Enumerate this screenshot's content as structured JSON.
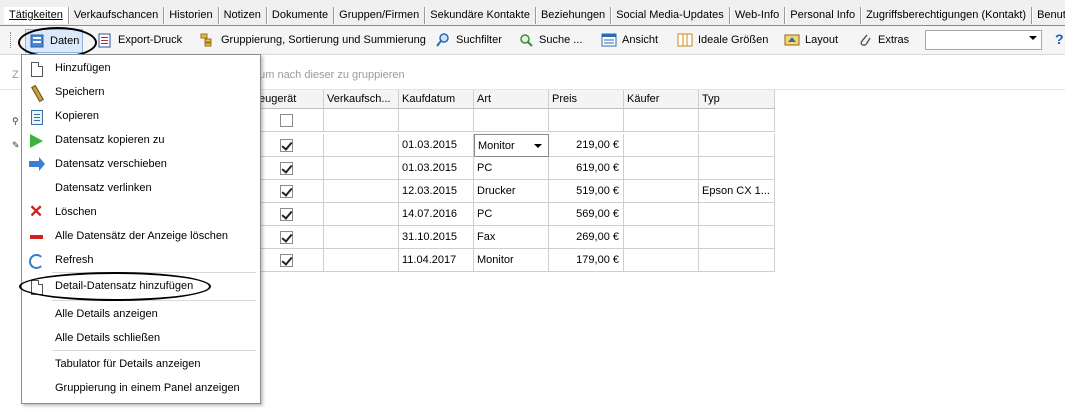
{
  "tabs": [
    "Tätigkeiten",
    "Verkaufschancen",
    "Historien",
    "Notizen",
    "Dokumente",
    "Gruppen/Firmen",
    "Sekundäre Kontakte",
    "Beziehungen",
    "Social Media-Updates",
    "Web-Info",
    "Personal Info",
    "Zugriffsberechtigungen (Kontakt)",
    "Benutze"
  ],
  "toolbar": {
    "daten": "Daten",
    "export": "Export-Druck",
    "grouping": "Gruppierung, Sortierung und Summierung",
    "suchfilter": "Suchfilter",
    "suche": "Suche ...",
    "ansicht": "Ansicht",
    "ideale": "Ideale Größen",
    "layout": "Layout",
    "extras": "Extras",
    "select_value": ""
  },
  "group_hint": "Z",
  "group_hint_rest": ", um nach dieser zu gruppieren",
  "columns": [
    "eugerät",
    "Verkaufsch...",
    "Kaufdatum",
    "Art",
    "Preis",
    "Käufer",
    "Typ"
  ],
  "rows": [
    {
      "geraet": true,
      "vk": "",
      "datum": "01.03.2015",
      "art": "Monitor",
      "preis": "219,00 €",
      "kaeufer": "",
      "typ": ""
    },
    {
      "geraet": true,
      "vk": "",
      "datum": "01.03.2015",
      "art": "PC",
      "preis": "619,00 €",
      "kaeufer": "",
      "typ": ""
    },
    {
      "geraet": true,
      "vk": "",
      "datum": "12.03.2015",
      "art": "Drucker",
      "preis": "519,00 €",
      "kaeufer": "",
      "typ": "Epson CX 1..."
    },
    {
      "geraet": true,
      "vk": "",
      "datum": "14.07.2016",
      "art": "PC",
      "preis": "569,00 €",
      "kaeufer": "",
      "typ": ""
    },
    {
      "geraet": true,
      "vk": "",
      "datum": "31.10.2015",
      "art": "Fax",
      "preis": "269,00 €",
      "kaeufer": "",
      "typ": ""
    },
    {
      "geraet": true,
      "vk": "",
      "datum": "11.04.2017",
      "art": "Monitor",
      "preis": "179,00 €",
      "kaeufer": "",
      "typ": ""
    }
  ],
  "menu": {
    "items": [
      {
        "label": "Hinzufügen",
        "icon": "document-icon"
      },
      {
        "label": "Speichern",
        "icon": "pencil-icon"
      },
      {
        "label": "Kopieren",
        "icon": "copy-icon"
      },
      {
        "label": "Datensatz kopieren zu",
        "icon": "play-icon"
      },
      {
        "label": "Datensatz verschieben",
        "icon": "arrow-right-icon"
      },
      {
        "label": "Datensatz verlinken",
        "icon": ""
      },
      {
        "label": "Löschen",
        "icon": "delete-icon"
      },
      {
        "label": "Alle Datensätz der Anzeige löschen",
        "icon": "minus-icon"
      },
      {
        "label": "Refresh",
        "icon": "refresh-icon"
      },
      {
        "label": "Detail-Datensatz hinzufügen",
        "icon": "document-icon"
      },
      {
        "label": "Alle Details anzeigen",
        "icon": ""
      },
      {
        "label": "Alle Details schließen",
        "icon": ""
      },
      {
        "label": "Tabulator für Details anzeigen",
        "icon": ""
      },
      {
        "label": "Gruppierung in einem Panel anzeigen",
        "icon": ""
      }
    ]
  }
}
